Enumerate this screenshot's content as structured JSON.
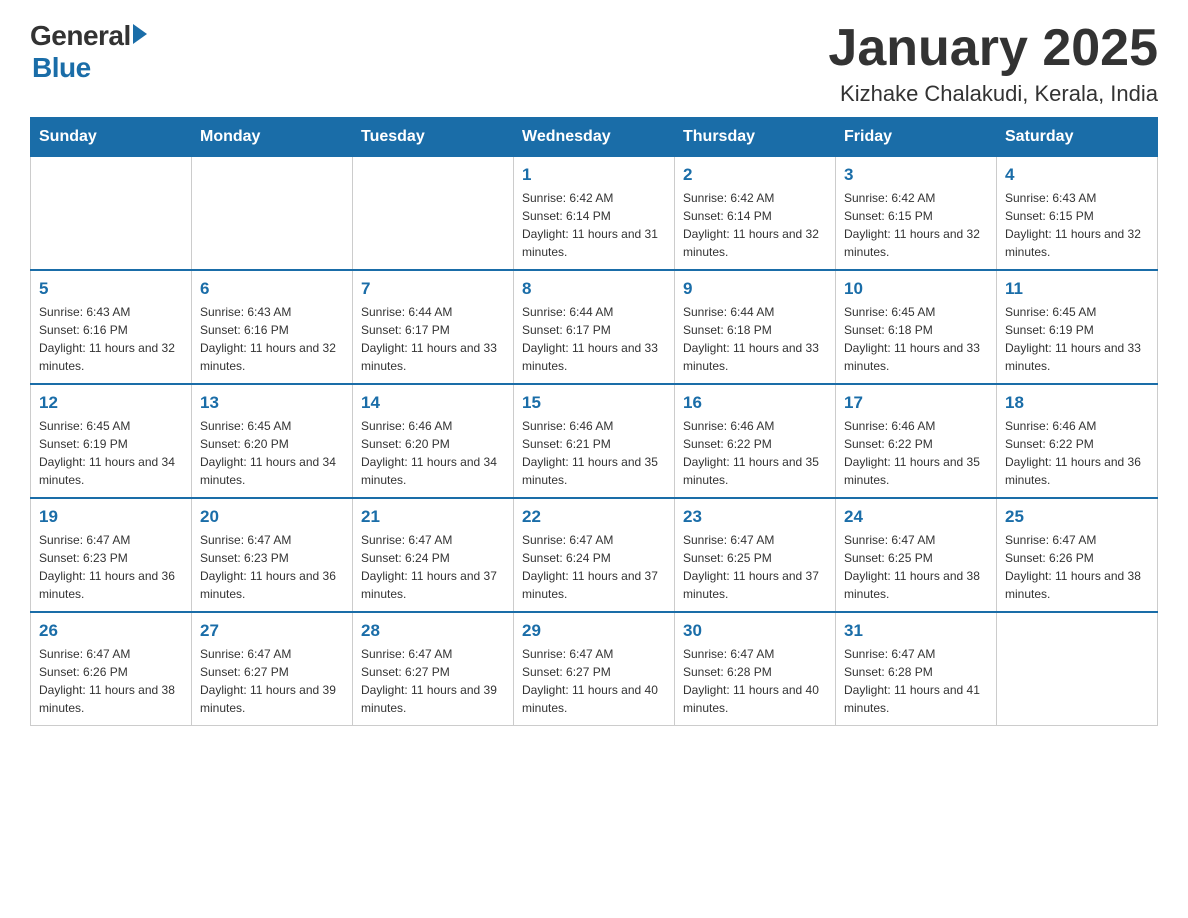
{
  "header": {
    "logo_general": "General",
    "logo_blue": "Blue",
    "title": "January 2025",
    "subtitle": "Kizhake Chalakudi, Kerala, India"
  },
  "weekdays": [
    "Sunday",
    "Monday",
    "Tuesday",
    "Wednesday",
    "Thursday",
    "Friday",
    "Saturday"
  ],
  "weeks": [
    [
      {
        "day": "",
        "info": ""
      },
      {
        "day": "",
        "info": ""
      },
      {
        "day": "",
        "info": ""
      },
      {
        "day": "1",
        "info": "Sunrise: 6:42 AM\nSunset: 6:14 PM\nDaylight: 11 hours and 31 minutes."
      },
      {
        "day": "2",
        "info": "Sunrise: 6:42 AM\nSunset: 6:14 PM\nDaylight: 11 hours and 32 minutes."
      },
      {
        "day": "3",
        "info": "Sunrise: 6:42 AM\nSunset: 6:15 PM\nDaylight: 11 hours and 32 minutes."
      },
      {
        "day": "4",
        "info": "Sunrise: 6:43 AM\nSunset: 6:15 PM\nDaylight: 11 hours and 32 minutes."
      }
    ],
    [
      {
        "day": "5",
        "info": "Sunrise: 6:43 AM\nSunset: 6:16 PM\nDaylight: 11 hours and 32 minutes."
      },
      {
        "day": "6",
        "info": "Sunrise: 6:43 AM\nSunset: 6:16 PM\nDaylight: 11 hours and 32 minutes."
      },
      {
        "day": "7",
        "info": "Sunrise: 6:44 AM\nSunset: 6:17 PM\nDaylight: 11 hours and 33 minutes."
      },
      {
        "day": "8",
        "info": "Sunrise: 6:44 AM\nSunset: 6:17 PM\nDaylight: 11 hours and 33 minutes."
      },
      {
        "day": "9",
        "info": "Sunrise: 6:44 AM\nSunset: 6:18 PM\nDaylight: 11 hours and 33 minutes."
      },
      {
        "day": "10",
        "info": "Sunrise: 6:45 AM\nSunset: 6:18 PM\nDaylight: 11 hours and 33 minutes."
      },
      {
        "day": "11",
        "info": "Sunrise: 6:45 AM\nSunset: 6:19 PM\nDaylight: 11 hours and 33 minutes."
      }
    ],
    [
      {
        "day": "12",
        "info": "Sunrise: 6:45 AM\nSunset: 6:19 PM\nDaylight: 11 hours and 34 minutes."
      },
      {
        "day": "13",
        "info": "Sunrise: 6:45 AM\nSunset: 6:20 PM\nDaylight: 11 hours and 34 minutes."
      },
      {
        "day": "14",
        "info": "Sunrise: 6:46 AM\nSunset: 6:20 PM\nDaylight: 11 hours and 34 minutes."
      },
      {
        "day": "15",
        "info": "Sunrise: 6:46 AM\nSunset: 6:21 PM\nDaylight: 11 hours and 35 minutes."
      },
      {
        "day": "16",
        "info": "Sunrise: 6:46 AM\nSunset: 6:22 PM\nDaylight: 11 hours and 35 minutes."
      },
      {
        "day": "17",
        "info": "Sunrise: 6:46 AM\nSunset: 6:22 PM\nDaylight: 11 hours and 35 minutes."
      },
      {
        "day": "18",
        "info": "Sunrise: 6:46 AM\nSunset: 6:22 PM\nDaylight: 11 hours and 36 minutes."
      }
    ],
    [
      {
        "day": "19",
        "info": "Sunrise: 6:47 AM\nSunset: 6:23 PM\nDaylight: 11 hours and 36 minutes."
      },
      {
        "day": "20",
        "info": "Sunrise: 6:47 AM\nSunset: 6:23 PM\nDaylight: 11 hours and 36 minutes."
      },
      {
        "day": "21",
        "info": "Sunrise: 6:47 AM\nSunset: 6:24 PM\nDaylight: 11 hours and 37 minutes."
      },
      {
        "day": "22",
        "info": "Sunrise: 6:47 AM\nSunset: 6:24 PM\nDaylight: 11 hours and 37 minutes."
      },
      {
        "day": "23",
        "info": "Sunrise: 6:47 AM\nSunset: 6:25 PM\nDaylight: 11 hours and 37 minutes."
      },
      {
        "day": "24",
        "info": "Sunrise: 6:47 AM\nSunset: 6:25 PM\nDaylight: 11 hours and 38 minutes."
      },
      {
        "day": "25",
        "info": "Sunrise: 6:47 AM\nSunset: 6:26 PM\nDaylight: 11 hours and 38 minutes."
      }
    ],
    [
      {
        "day": "26",
        "info": "Sunrise: 6:47 AM\nSunset: 6:26 PM\nDaylight: 11 hours and 38 minutes."
      },
      {
        "day": "27",
        "info": "Sunrise: 6:47 AM\nSunset: 6:27 PM\nDaylight: 11 hours and 39 minutes."
      },
      {
        "day": "28",
        "info": "Sunrise: 6:47 AM\nSunset: 6:27 PM\nDaylight: 11 hours and 39 minutes."
      },
      {
        "day": "29",
        "info": "Sunrise: 6:47 AM\nSunset: 6:27 PM\nDaylight: 11 hours and 40 minutes."
      },
      {
        "day": "30",
        "info": "Sunrise: 6:47 AM\nSunset: 6:28 PM\nDaylight: 11 hours and 40 minutes."
      },
      {
        "day": "31",
        "info": "Sunrise: 6:47 AM\nSunset: 6:28 PM\nDaylight: 11 hours and 41 minutes."
      },
      {
        "day": "",
        "info": ""
      }
    ]
  ]
}
